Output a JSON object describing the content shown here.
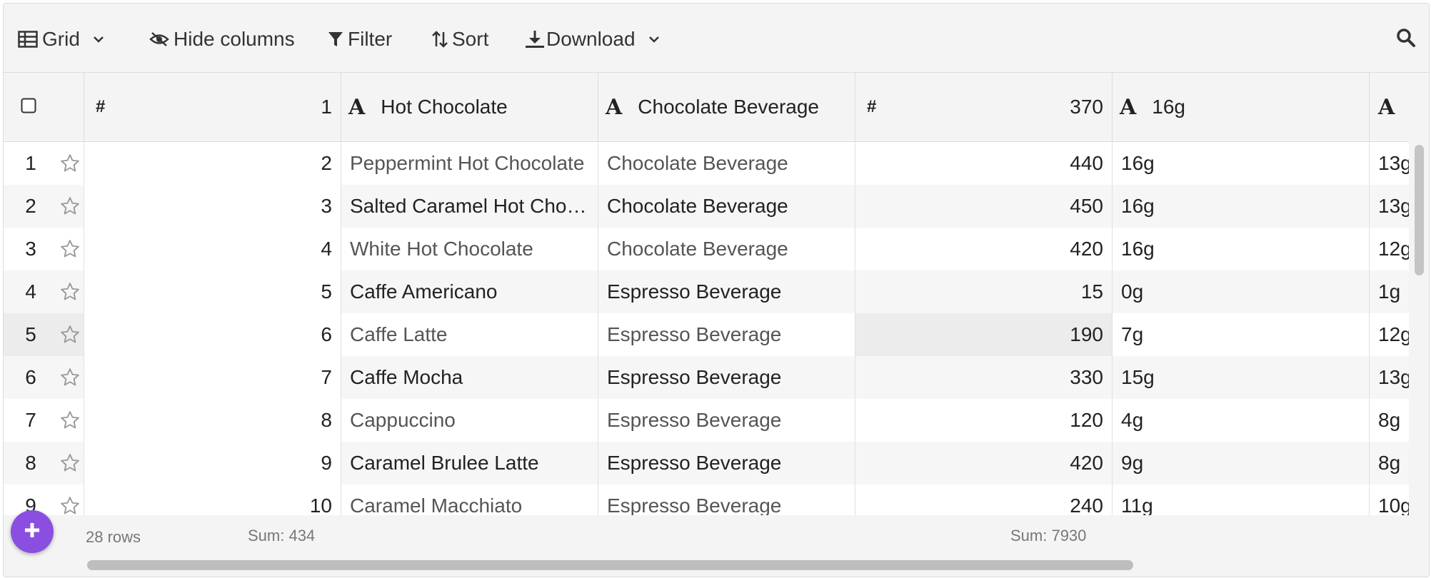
{
  "toolbar": {
    "view_label": "Grid",
    "hide_columns_label": "Hide columns",
    "filter_label": "Filter",
    "sort_label": "Sort",
    "download_label": "Download"
  },
  "header": {
    "col1_type": "#",
    "col1_value": "1",
    "col2_type": "A",
    "col2_value": "Hot Chocolate",
    "col3_type": "A",
    "col3_value": "Chocolate Beverage",
    "col4_type": "#",
    "col4_value": "370",
    "col5_type": "A",
    "col5_value": "16g",
    "col6_type": "A"
  },
  "rows": [
    {
      "n": "1",
      "id": "2",
      "name": "Peppermint Hot Chocolate",
      "cat": "Chocolate Beverage",
      "cal": "440",
      "fat": "16g",
      "extra": "13g"
    },
    {
      "n": "2",
      "id": "3",
      "name": "Salted Caramel Hot Cho…",
      "cat": "Chocolate Beverage",
      "cal": "450",
      "fat": "16g",
      "extra": "13g"
    },
    {
      "n": "3",
      "id": "4",
      "name": "White Hot Chocolate",
      "cat": "Chocolate Beverage",
      "cal": "420",
      "fat": "16g",
      "extra": "12g"
    },
    {
      "n": "4",
      "id": "5",
      "name": "Caffe Americano",
      "cat": "Espresso Beverage",
      "cal": "15",
      "fat": "0g",
      "extra": "1g"
    },
    {
      "n": "5",
      "id": "6",
      "name": "Caffe Latte",
      "cat": "Espresso Beverage",
      "cal": "190",
      "fat": "7g",
      "extra": "12g"
    },
    {
      "n": "6",
      "id": "7",
      "name": "Caffe Mocha",
      "cat": "Espresso Beverage",
      "cal": "330",
      "fat": "15g",
      "extra": "13g"
    },
    {
      "n": "7",
      "id": "8",
      "name": "Cappuccino",
      "cat": "Espresso Beverage",
      "cal": "120",
      "fat": "4g",
      "extra": "8g"
    },
    {
      "n": "8",
      "id": "9",
      "name": "Caramel Brulee Latte",
      "cat": "Espresso Beverage",
      "cal": "420",
      "fat": "9g",
      "extra": "8g"
    },
    {
      "n": "9",
      "id": "10",
      "name": "Caramel Macchiato",
      "cat": "Espresso Beverage",
      "cal": "240",
      "fat": "11g",
      "extra": "10g"
    }
  ],
  "footer": {
    "row_count": "28 rows",
    "sum_id": "Sum: 434",
    "sum_cal": "Sum: 7930"
  },
  "colors": {
    "accent": "#8a4fe0",
    "grid_border": "#e1e1e1",
    "header_bg": "#f4f4f4"
  }
}
